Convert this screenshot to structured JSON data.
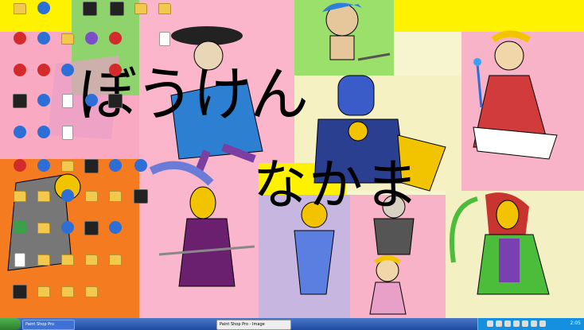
{
  "wallpaper": {
    "title_line1": "ぼうけん",
    "title_line2": "なかま"
  },
  "desktop_icons": [
    {
      "label": "",
      "type": "folder"
    },
    {
      "label": "",
      "type": "app-blue"
    },
    {
      "label": "",
      "type": "app-dark"
    },
    {
      "label": "",
      "type": "app-dark"
    },
    {
      "label": "",
      "type": "folder"
    },
    {
      "label": "",
      "type": "folder"
    },
    {
      "label": "",
      "type": "app-red"
    },
    {
      "label": "",
      "type": "app-blue"
    },
    {
      "label": "",
      "type": "folder"
    },
    {
      "label": "",
      "type": "app-purple"
    },
    {
      "label": "",
      "type": "app-red"
    },
    {
      "label": "",
      "type": "app-doc"
    },
    {
      "label": "",
      "type": "app-red"
    },
    {
      "label": "",
      "type": "app-red"
    },
    {
      "label": "",
      "type": "app-blue"
    },
    {
      "label": "",
      "type": "app-red"
    },
    {
      "label": "",
      "type": "app-dark"
    },
    {
      "label": "",
      "type": "app-blue"
    },
    {
      "label": "",
      "type": "app-doc"
    },
    {
      "label": "",
      "type": "app-blue"
    },
    {
      "label": "",
      "type": "app-dark"
    },
    {
      "label": "",
      "type": "app-blue"
    },
    {
      "label": "",
      "type": "app-blue"
    },
    {
      "label": "",
      "type": "app-doc"
    },
    {
      "label": "",
      "type": "app-red"
    },
    {
      "label": "",
      "type": "app-blue"
    },
    {
      "label": "",
      "type": "folder"
    },
    {
      "label": "",
      "type": "app-dark"
    },
    {
      "label": "",
      "type": "app-blue"
    },
    {
      "label": "",
      "type": "app-blue"
    },
    {
      "label": "",
      "type": "folder"
    },
    {
      "label": "",
      "type": "folder"
    },
    {
      "label": "",
      "type": "app-blue"
    },
    {
      "label": "",
      "type": "folder"
    },
    {
      "label": "",
      "type": "folder"
    },
    {
      "label": "",
      "type": "app-dark"
    },
    {
      "label": "",
      "type": "app-green"
    },
    {
      "label": "",
      "type": "folder"
    },
    {
      "label": "",
      "type": "app-blue"
    },
    {
      "label": "",
      "type": "app-dark"
    },
    {
      "label": "",
      "type": "app-blue"
    },
    {
      "label": "",
      "type": "app-doc"
    },
    {
      "label": "",
      "type": "folder"
    },
    {
      "label": "",
      "type": "folder"
    },
    {
      "label": "",
      "type": "folder"
    },
    {
      "label": "",
      "type": "folder"
    },
    {
      "label": "",
      "type": "app-dark"
    },
    {
      "label": "",
      "type": "folder"
    },
    {
      "label": "",
      "type": "folder"
    },
    {
      "label": "",
      "type": "folder"
    }
  ],
  "taskbar": {
    "btn1_label": "Paint Shop Pro",
    "btn2_label": "Paint Shop Pro - Image",
    "clock": "2:05"
  },
  "colors": {
    "taskbar": "#1d4aa0",
    "start": "#3aa03a",
    "tray": "#1590e0"
  }
}
